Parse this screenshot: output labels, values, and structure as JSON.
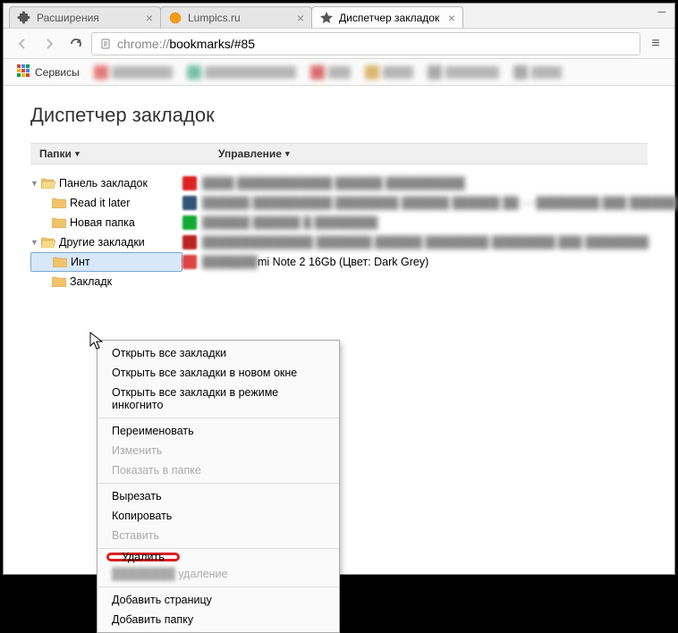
{
  "tabs": [
    {
      "title": "Расширения",
      "active": false,
      "favicon": "puzzle"
    },
    {
      "title": "Lumpics.ru",
      "active": false,
      "favicon": "orange"
    },
    {
      "title": "Диспетчер закладок",
      "active": true,
      "favicon": "star"
    }
  ],
  "omnibox": {
    "protocol": "chrome://",
    "rest": "bookmarks/#85"
  },
  "bookmark_bar": {
    "services_label": "Сервисы"
  },
  "page": {
    "title": "Диспетчер закладок",
    "col_folders": "Папки",
    "col_manage": "Управление"
  },
  "folders": {
    "panel": "Панель закладок",
    "read_later": "Read it later",
    "new_folder": "Новая папка",
    "other": "Другие закладки",
    "selected_partial": "Инт",
    "bookmarks": "Закладк"
  },
  "list": {
    "row5_text": "mi Note 2 16Gb (Цвет: Dark Grey)"
  },
  "context_menu": {
    "open_all": "Открыть все закладки",
    "open_all_new_window": "Открыть все закладки в новом окне",
    "open_all_incognito": "Открыть все закладки в режиме инкогнито",
    "rename": "Переименовать",
    "edit": "Изменить",
    "show_in_folder": "Показать в папке",
    "cut": "Вырезать",
    "copy": "Копировать",
    "paste": "Вставить",
    "delete": "Удалить",
    "undo_delete": "удаление",
    "add_page": "Добавить страницу",
    "add_folder": "Добавить папку"
  }
}
